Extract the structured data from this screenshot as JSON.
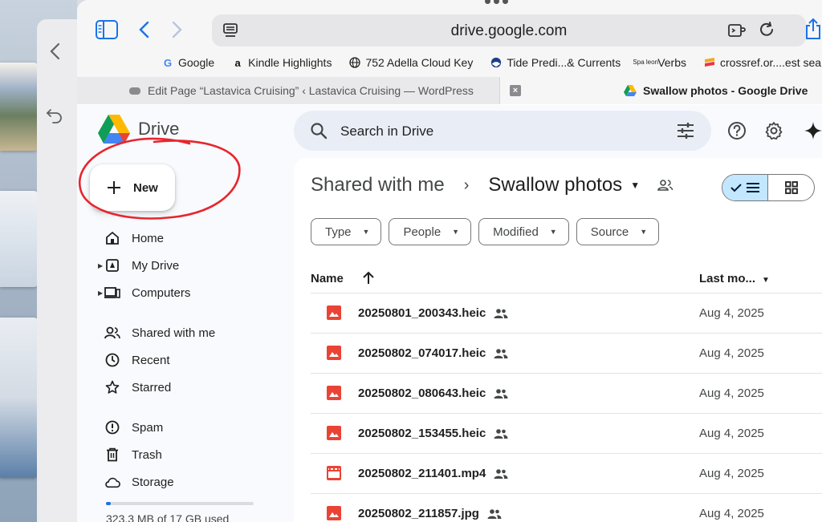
{
  "browser": {
    "url": "drive.google.com",
    "bookmarks": [
      {
        "label": "Google",
        "icon": "google-icon"
      },
      {
        "label": "Kindle Highlights",
        "icon": "amazon-icon"
      },
      {
        "label": "752 Adella Cloud Key",
        "icon": "globe-icon"
      },
      {
        "label": "Tide Predi...& Currents",
        "icon": "noaa-icon"
      },
      {
        "label": "Verbs",
        "icon": "spaleon-icon",
        "icon_text": "Spa leon"
      },
      {
        "label": "crossref.or....est search",
        "icon": "crossref-icon"
      }
    ],
    "tabs": [
      {
        "label": "Edit Page “Lastavica Cruising” ‹ Lastavica Cruising — WordPress",
        "active": false
      },
      {
        "label": "Swallow photos - Google Drive",
        "active": true
      }
    ]
  },
  "drive": {
    "logo_text": "Drive",
    "new_label": "New",
    "nav": [
      {
        "label": "Home",
        "icon": "home-icon"
      },
      {
        "label": "My Drive",
        "icon": "my-drive-icon",
        "caret": true
      },
      {
        "label": "Computers",
        "icon": "computers-icon",
        "caret": true
      },
      {
        "label": "Shared with me",
        "icon": "shared-icon"
      },
      {
        "label": "Recent",
        "icon": "clock-icon"
      },
      {
        "label": "Starred",
        "icon": "star-icon"
      },
      {
        "label": "Spam",
        "icon": "spam-icon"
      },
      {
        "label": "Trash",
        "icon": "trash-icon"
      },
      {
        "label": "Storage",
        "icon": "cloud-icon"
      }
    ],
    "storage_text": "323.3 MB of 17 GB used",
    "storage_fraction": 0.019,
    "search_placeholder": "Search in Drive",
    "breadcrumb": {
      "parent": "Shared with me",
      "current": "Swallow photos"
    },
    "filters": [
      "Type",
      "People",
      "Modified",
      "Source"
    ],
    "columns": {
      "name": "Name",
      "modified": "Last mo..."
    },
    "files": [
      {
        "name": "20250801_200343.heic",
        "type": "image",
        "date": "Aug 4, 2025"
      },
      {
        "name": "20250802_074017.heic",
        "type": "image",
        "date": "Aug 4, 2025"
      },
      {
        "name": "20250802_080643.heic",
        "type": "image",
        "date": "Aug 4, 2025"
      },
      {
        "name": "20250802_153455.heic",
        "type": "image",
        "date": "Aug 4, 2025"
      },
      {
        "name": "20250802_211401.mp4",
        "type": "video",
        "date": "Aug 4, 2025"
      },
      {
        "name": "20250802_211857.jpg",
        "type": "image",
        "date": "Aug 4, 2025"
      }
    ]
  },
  "colors": {
    "accent": "#1a73e8",
    "file_icon_red": "#ea4335",
    "annotation_red": "#e8252d",
    "view_toggle_active": "#c2e7ff"
  }
}
